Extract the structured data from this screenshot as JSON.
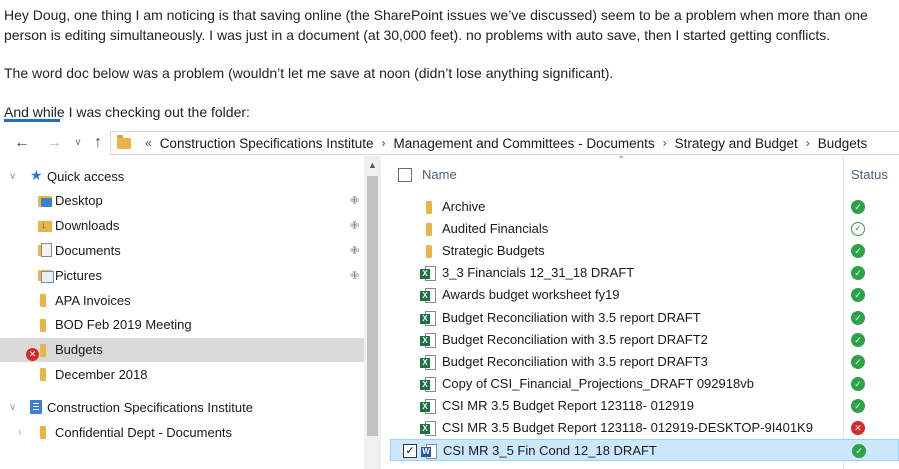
{
  "email": {
    "paragraph1": "Hey Doug, one thing I am noticing is that saving online (the SharePoint issues we’ve discussed) seem to be a problem when more than one person is editing simultaneously. I was just in a document (at 30,000 feet). no problems with auto save, then I started getting conflicts.",
    "paragraph2": "The word doc below was a problem (wouldn’t let me save at noon (didn’t lose anything significant).",
    "paragraph3": "And while I was checking out the folder:"
  },
  "address_bar": {
    "crumbs": [
      "Construction Specifications Institute",
      "Management and Committees - Documents",
      "Strategy and Budget",
      "Budgets"
    ]
  },
  "nav_tree": [
    {
      "label": "Quick access",
      "icon": "star-icon",
      "level": 0,
      "expander": "chevron-down"
    },
    {
      "label": "Desktop",
      "icon": "desktop-folder-icon",
      "level": 1,
      "pinned": true
    },
    {
      "label": "Downloads",
      "icon": "downloads-folder-icon",
      "level": 1,
      "pinned": true
    },
    {
      "label": "Documents",
      "icon": "documents-folder-icon",
      "level": 1,
      "pinned": true
    },
    {
      "label": "Pictures",
      "icon": "pictures-folder-icon",
      "level": 1,
      "pinned": true
    },
    {
      "label": "APA Invoices",
      "icon": "folder-icon",
      "level": 1
    },
    {
      "label": "BOD Feb 2019 Meeting",
      "icon": "folder-icon",
      "level": 1
    },
    {
      "label": "Budgets",
      "icon": "folder-icon",
      "level": 1,
      "selected": true,
      "status": "error"
    },
    {
      "label": "December 2018",
      "icon": "folder-icon",
      "level": 1
    },
    {
      "label": "Construction Specifications Institute",
      "icon": "sharepoint-site-icon",
      "level": 0,
      "expander": "chevron-down"
    },
    {
      "label": "Confidential Dept - Documents",
      "icon": "folder-icon",
      "level": 1,
      "expander": "chevron-right"
    }
  ],
  "columns": {
    "name": "Name",
    "status": "Status"
  },
  "files": [
    {
      "name": "Archive",
      "type": "folder",
      "status": "synced"
    },
    {
      "name": "Audited Financials",
      "type": "folder",
      "status": "available"
    },
    {
      "name": "Strategic Budgets",
      "type": "folder",
      "status": "synced"
    },
    {
      "name": "3_3 Financials 12_31_18 DRAFT",
      "type": "excel",
      "status": "synced"
    },
    {
      "name": "Awards budget worksheet fy19",
      "type": "excel",
      "status": "synced"
    },
    {
      "name": "Budget Reconciliation with 3.5 report DRAFT",
      "type": "excel",
      "status": "synced"
    },
    {
      "name": "Budget Reconciliation with 3.5 report DRAFT2",
      "type": "excel",
      "status": "synced"
    },
    {
      "name": "Budget Reconciliation with 3.5 report DRAFT3",
      "type": "excel",
      "status": "synced"
    },
    {
      "name": "Copy of CSI_Financial_Projections_DRAFT 092918vb",
      "type": "excel",
      "status": "synced"
    },
    {
      "name": "CSI MR 3.5 Budget Report 123118- 012919",
      "type": "excel",
      "status": "synced"
    },
    {
      "name": "CSI MR 3.5 Budget Report 123118- 012919-DESKTOP-9I401K9",
      "type": "excel",
      "status": "error"
    },
    {
      "name": "CSI MR 3_5 Fin Cond 12_18 DRAFT",
      "type": "word",
      "status": "synced",
      "selected": true,
      "checked": true
    }
  ],
  "colors": {
    "accent": "#1f6fc5",
    "selection": "#cce8ff",
    "ok": "#2da24a",
    "error": "#d42a2a",
    "folder": "#e8b647"
  }
}
